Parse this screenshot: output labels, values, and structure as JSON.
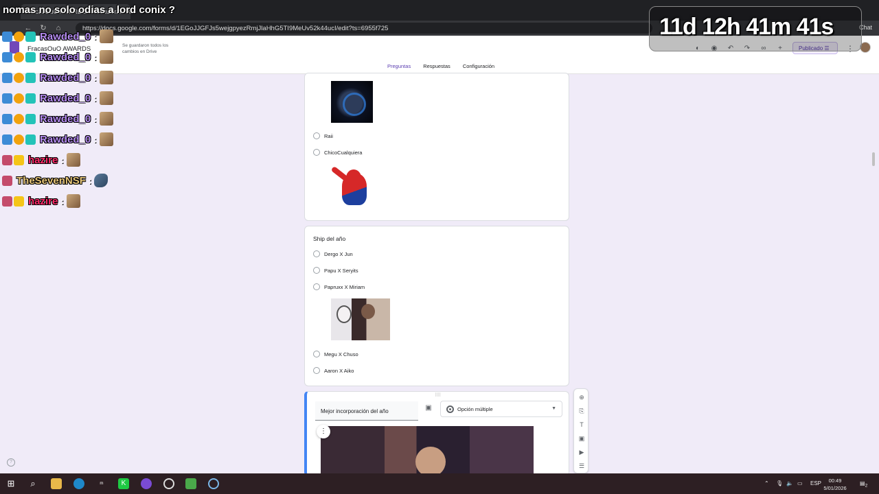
{
  "browser": {
    "tab_title": "FracasOuO AWARDS - Formulario - X",
    "url": "https://docs.google.com/forms/d/1EGoJJGFJs5wejgpyezRmjJlaHhG5TI9MeUv52k44ucI/edit?ts=6955f725",
    "chat_label": "Chat"
  },
  "forms_header": {
    "title": "FracasOuO AWARDS",
    "saved_note": "Se guardaron todos los cambios en Drive",
    "publish_label": "Publicado",
    "tabs": [
      {
        "label": "Preguntas",
        "active": true
      },
      {
        "label": "Respuestas",
        "active": false
      },
      {
        "label": "Configuración",
        "active": false
      }
    ]
  },
  "card1": {
    "options": [
      "Raii",
      "ChicoCualquiera"
    ]
  },
  "card2": {
    "question": "Ship del año",
    "options": [
      "Dergo X Jun",
      "Papu X Seryits",
      "Papruxx X Miriam",
      "Megu X Chuso",
      "Aaron X Aiko"
    ]
  },
  "card3": {
    "question": "Mejor incorporación del año",
    "type": "Opción múltiple"
  },
  "overlay": {
    "title": "nomas no solo odias a lord conix ?",
    "timer": "11d 12h 41m 41s"
  },
  "chat": [
    {
      "user": "Rawded_0",
      "color": "#b58cf0"
    },
    {
      "user": "Rawded_0",
      "color": "#b58cf0"
    },
    {
      "user": "Rawded_0",
      "color": "#b58cf0"
    },
    {
      "user": "Rawded_0",
      "color": "#b58cf0"
    },
    {
      "user": "Rawded_0",
      "color": "#b58cf0"
    },
    {
      "user": "Rawded_0",
      "color": "#b58cf0"
    },
    {
      "user": "hazire",
      "color": "#ff2a6a"
    },
    {
      "user": "TheSevenNSF",
      "color": "#e8c77a"
    },
    {
      "user": "hazire",
      "color": "#ff2a6a"
    }
  ],
  "taskbar": {
    "language": "ESP",
    "time": "00:49",
    "date": "5/01/2026",
    "notifications": "2"
  }
}
